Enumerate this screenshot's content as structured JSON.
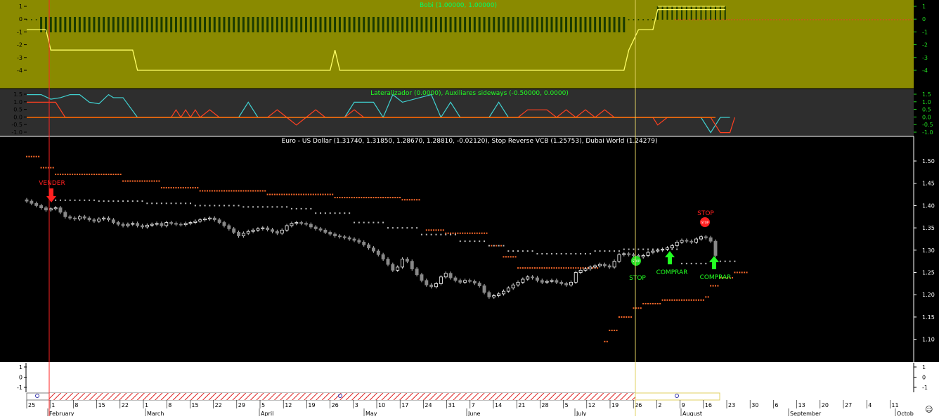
{
  "colors": {
    "olive_bg": "#8a8a00",
    "olive_line": "#ffff66",
    "olive_bar": "#1a3a00",
    "panel2_bg": "#2e2e2e",
    "main_bg": "#000000",
    "up_candle": "#ffffff",
    "down_candle": "#888888",
    "stop_orange": "#ff6a2a",
    "stop_white": "#cccccc",
    "red_marker": "#ff2020",
    "green_marker": "#22ff22",
    "cyan_line": "#40d0d0",
    "orange_line": "#ff7a1a",
    "axis_green": "#22dd22",
    "vline_red": "#ff2222",
    "vline_yellow": "#e0d060",
    "hatch_red": "#dd2222"
  },
  "panel1": {
    "title": "Bobi (1.00000, 1.00000)",
    "ticks": [
      "1",
      "0",
      "-1",
      "-2",
      "-3",
      "-4"
    ],
    "right_ticks": [
      "1",
      "0",
      "-1",
      "-2",
      "-3",
      "-4"
    ]
  },
  "panel2": {
    "title": "Lateralizador (0.0000), Auxiliares sideways (-0.50000, 0.0000)",
    "ticks": [
      "1.5",
      "1.0",
      "0.5",
      "0.0",
      "-0.5",
      "-1.0"
    ]
  },
  "panel3": {
    "title": "Euro - US Dollar (1.31740, 1.31850, 1.28670, 1.28810, -0.02120), Stop Reverse VCB (1.25753), Dubai World (1.24279)",
    "ticks": [
      "1.50",
      "1.45",
      "1.40",
      "1.35",
      "1.30",
      "1.25",
      "1.20",
      "1.15",
      "1.10"
    ]
  },
  "panel4": {
    "ticks": [
      "1",
      "0",
      "-1"
    ]
  },
  "markers": {
    "vender": "VENDER",
    "stop_red": "STOP",
    "stop_green": "STOP",
    "comprar1": "COMPRAR",
    "comprar2": "COMPRAR",
    "stop_sign_text": "STOP"
  },
  "x_axis": {
    "day_labels": [
      "25",
      "1",
      "8",
      "15",
      "22",
      "1",
      "8",
      "15",
      "22",
      "29",
      "5",
      "12",
      "19",
      "26",
      "3",
      "10",
      "17",
      "24",
      "31",
      "7",
      "14",
      "21",
      "28",
      "5",
      "12",
      "19",
      "26",
      "2",
      "9",
      "16",
      "23",
      "30",
      "6",
      "13",
      "20",
      "27",
      "4",
      "11"
    ],
    "month_labels": [
      "February",
      "March",
      "April",
      "May",
      "June",
      "July",
      "August",
      "September",
      "Octob"
    ]
  },
  "chart_data": {
    "type": "candlestick",
    "title": "Euro - US Dollar (1.31740, 1.31850, 1.28670, 1.28810, -0.02120), Stop Reverse VCB (1.25753), Dubai World (1.24279)",
    "ylim": [
      1.06,
      1.53
    ],
    "last_ohlc": {
      "open": 1.3174,
      "high": 1.3185,
      "low": 1.2867,
      "close": 1.2881,
      "change": -0.0212
    },
    "closes": [
      1.41,
      1.405,
      1.4,
      1.395,
      1.39,
      1.393,
      1.395,
      1.385,
      1.375,
      1.372,
      1.37,
      1.375,
      1.372,
      1.368,
      1.365,
      1.37,
      1.372,
      1.368,
      1.362,
      1.358,
      1.355,
      1.358,
      1.36,
      1.355,
      1.352,
      1.356,
      1.358,
      1.36,
      1.355,
      1.362,
      1.36,
      1.358,
      1.357,
      1.36,
      1.362,
      1.365,
      1.368,
      1.37,
      1.372,
      1.368,
      1.362,
      1.355,
      1.348,
      1.34,
      1.332,
      1.338,
      1.342,
      1.345,
      1.348,
      1.35,
      1.346,
      1.342,
      1.338,
      1.345,
      1.355,
      1.36,
      1.362,
      1.36,
      1.358,
      1.352,
      1.348,
      1.345,
      1.34,
      1.336,
      1.332,
      1.33,
      1.328,
      1.325,
      1.322,
      1.318,
      1.312,
      1.305,
      1.298,
      1.29,
      1.28,
      1.268,
      1.255,
      1.262,
      1.28,
      1.275,
      1.258,
      1.245,
      1.232,
      1.222,
      1.218,
      1.225,
      1.24,
      1.248,
      1.238,
      1.232,
      1.228,
      1.232,
      1.23,
      1.226,
      1.22,
      1.205,
      1.195,
      1.198,
      1.202,
      1.208,
      1.215,
      1.222,
      1.228,
      1.235,
      1.24,
      1.238,
      1.232,
      1.228,
      1.23,
      1.232,
      1.228,
      1.225,
      1.222,
      1.228,
      1.25,
      1.255,
      1.258,
      1.262,
      1.265,
      1.268,
      1.265,
      1.262,
      1.275,
      1.29,
      1.292,
      1.29,
      1.288,
      1.285,
      1.288,
      1.295,
      1.298,
      1.3,
      1.302,
      1.305,
      1.31,
      1.318,
      1.322,
      1.32,
      1.318,
      1.325,
      1.33,
      1.328,
      1.32,
      1.288
    ],
    "stop_orange": [
      [
        0,
        1.51
      ],
      [
        3,
        1.485
      ],
      [
        6,
        1.47
      ],
      [
        20,
        1.455
      ],
      [
        28,
        1.44
      ],
      [
        36,
        1.433
      ],
      [
        50,
        1.425
      ],
      [
        64,
        1.418
      ],
      [
        78,
        1.413
      ],
      [
        82,
        1.4
      ],
      [
        83,
        1.345
      ],
      [
        87,
        1.338
      ],
      [
        96,
        1.31
      ],
      [
        99,
        1.285
      ],
      [
        102,
        1.26
      ],
      [
        119,
        1.26
      ],
      [
        120,
        1.095
      ],
      [
        121,
        1.12
      ],
      [
        123,
        1.15
      ],
      [
        126,
        1.17
      ],
      [
        128,
        1.18
      ],
      [
        132,
        1.188
      ],
      [
        141,
        1.195
      ],
      [
        142,
        1.22
      ],
      [
        144,
        1.238
      ],
      [
        147,
        1.25
      ],
      [
        150,
        1.258
      ]
    ],
    "stop_white": [
      [
        6,
        1.412
      ],
      [
        15,
        1.41
      ],
      [
        25,
        1.405
      ],
      [
        35,
        1.4
      ],
      [
        45,
        1.397
      ],
      [
        55,
        1.393
      ],
      [
        60,
        1.383
      ],
      [
        68,
        1.362
      ],
      [
        75,
        1.35
      ],
      [
        82,
        1.335
      ],
      [
        90,
        1.32
      ],
      [
        96,
        1.31
      ],
      [
        100,
        1.298
      ],
      [
        106,
        1.292
      ],
      [
        112,
        1.292
      ],
      [
        118,
        1.298
      ],
      [
        124,
        1.302
      ],
      [
        130,
        1.302
      ],
      [
        136,
        1.27
      ],
      [
        142,
        1.275
      ],
      [
        148,
        1.28
      ]
    ],
    "panel1_line": [
      [
        0,
        -1
      ],
      [
        4,
        -1
      ],
      [
        5,
        -3
      ],
      [
        22,
        -3
      ],
      [
        23,
        -5
      ],
      [
        63,
        -5
      ],
      [
        64,
        -3
      ],
      [
        65,
        -5
      ],
      [
        124,
        -5
      ],
      [
        125,
        -3
      ],
      [
        126,
        -2
      ],
      [
        127,
        -1
      ],
      [
        130,
        -1
      ],
      [
        131,
        1
      ],
      [
        132,
        1
      ],
      [
        145,
        1
      ]
    ],
    "panel2_cyan": [
      [
        0,
        1.5
      ],
      [
        3,
        1.5
      ],
      [
        5,
        1.2
      ],
      [
        7,
        1.3
      ],
      [
        9,
        1.5
      ],
      [
        11,
        1.5
      ],
      [
        13,
        1.0
      ],
      [
        15,
        0.9
      ],
      [
        17,
        1.5
      ],
      [
        18,
        1.3
      ],
      [
        20,
        1.3
      ],
      [
        23,
        0
      ],
      [
        44,
        0
      ],
      [
        46,
        1.0
      ],
      [
        48,
        0
      ],
      [
        66,
        0
      ],
      [
        68,
        1.0
      ],
      [
        72,
        1.0
      ],
      [
        74,
        0
      ],
      [
        76,
        1.5
      ],
      [
        78,
        1.0
      ],
      [
        84,
        1.5
      ],
      [
        86,
        0
      ],
      [
        88,
        1.0
      ],
      [
        90,
        0
      ],
      [
        96,
        0
      ],
      [
        98,
        1.0
      ],
      [
        100,
        0
      ],
      [
        140,
        0
      ],
      [
        142,
        -1
      ],
      [
        144,
        0
      ],
      [
        146,
        0
      ]
    ],
    "panel2_red": [
      [
        0,
        1.0
      ],
      [
        6,
        1.0
      ],
      [
        8,
        0
      ],
      [
        30,
        0
      ],
      [
        31,
        0.5
      ],
      [
        32,
        0
      ],
      [
        33,
        0.5
      ],
      [
        34,
        0
      ],
      [
        35,
        0.5
      ],
      [
        36,
        0
      ],
      [
        38,
        0.5
      ],
      [
        40,
        0
      ],
      [
        50,
        0
      ],
      [
        52,
        0.5
      ],
      [
        54,
        0
      ],
      [
        56,
        -0.5
      ],
      [
        58,
        0
      ],
      [
        60,
        0.5
      ],
      [
        62,
        0
      ],
      [
        66,
        0
      ],
      [
        68,
        0.5
      ],
      [
        70,
        0
      ],
      [
        102,
        0
      ],
      [
        104,
        0.5
      ],
      [
        108,
        0.5
      ],
      [
        110,
        0
      ],
      [
        112,
        0.5
      ],
      [
        114,
        0
      ],
      [
        116,
        0.5
      ],
      [
        118,
        0
      ],
      [
        120,
        0.5
      ],
      [
        122,
        0
      ],
      [
        130,
        0
      ],
      [
        131,
        -0.5
      ],
      [
        133,
        0
      ],
      [
        142,
        0
      ],
      [
        144,
        -1
      ],
      [
        146,
        -1
      ],
      [
        147,
        0
      ]
    ]
  }
}
